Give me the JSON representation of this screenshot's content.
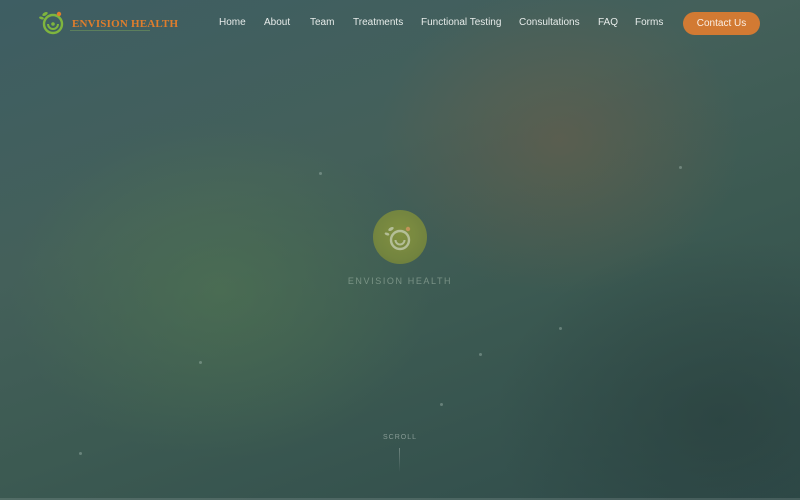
{
  "brand": {
    "name": "ENVISION HEALTH",
    "accent_color": "#d27a33",
    "logo_icon": "spiral-leaf-icon"
  },
  "nav": {
    "items": [
      {
        "label": "Home"
      },
      {
        "label": "About"
      },
      {
        "label": "Team"
      },
      {
        "label": "Treatments"
      },
      {
        "label": "Functional Testing"
      },
      {
        "label": "Consultations"
      },
      {
        "label": "FAQ"
      },
      {
        "label": "Forms"
      }
    ],
    "cta_label": "Contact Us"
  },
  "hero": {
    "brand_label": "ENVISION HEALTH",
    "scroll_label": "SCROLL"
  }
}
